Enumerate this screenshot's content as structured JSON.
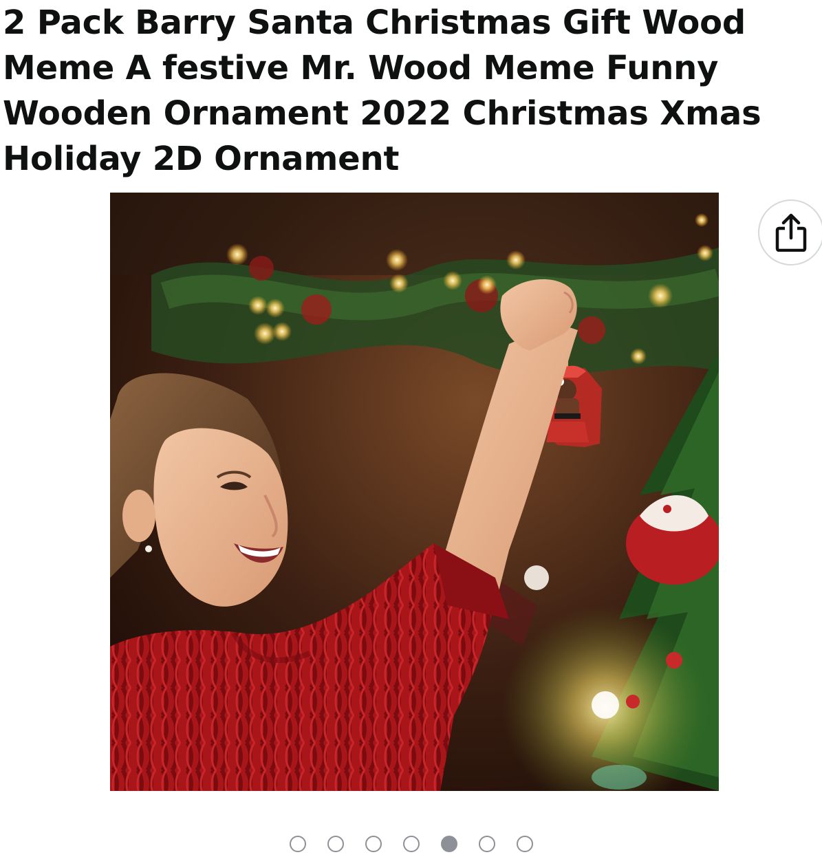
{
  "product": {
    "title": "2 Pack Barry Santa Christmas Gift Wood Meme A festive Mr. Wood Meme Funny Wooden Ornament 2022 Christmas Xmas Holiday 2D Ornament"
  },
  "gallery": {
    "image_alt": "Girl holding a wooden ornament near a Christmas tree",
    "share_icon": "share-icon",
    "dot_count": 7,
    "active_index": 4
  },
  "colors": {
    "text": "#0f1111",
    "dot_border": "#8d9096",
    "share_border": "#d5d9d9"
  }
}
